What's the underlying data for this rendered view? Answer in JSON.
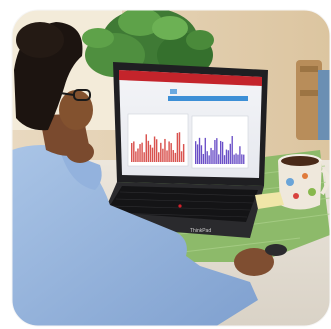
{
  "photo": {
    "laptop_brand": "ThinkPad",
    "screen": {
      "header_color": "#c4242b",
      "left_chart_color": "#d9534f",
      "right_chart_color": "#6a4fc7"
    }
  }
}
